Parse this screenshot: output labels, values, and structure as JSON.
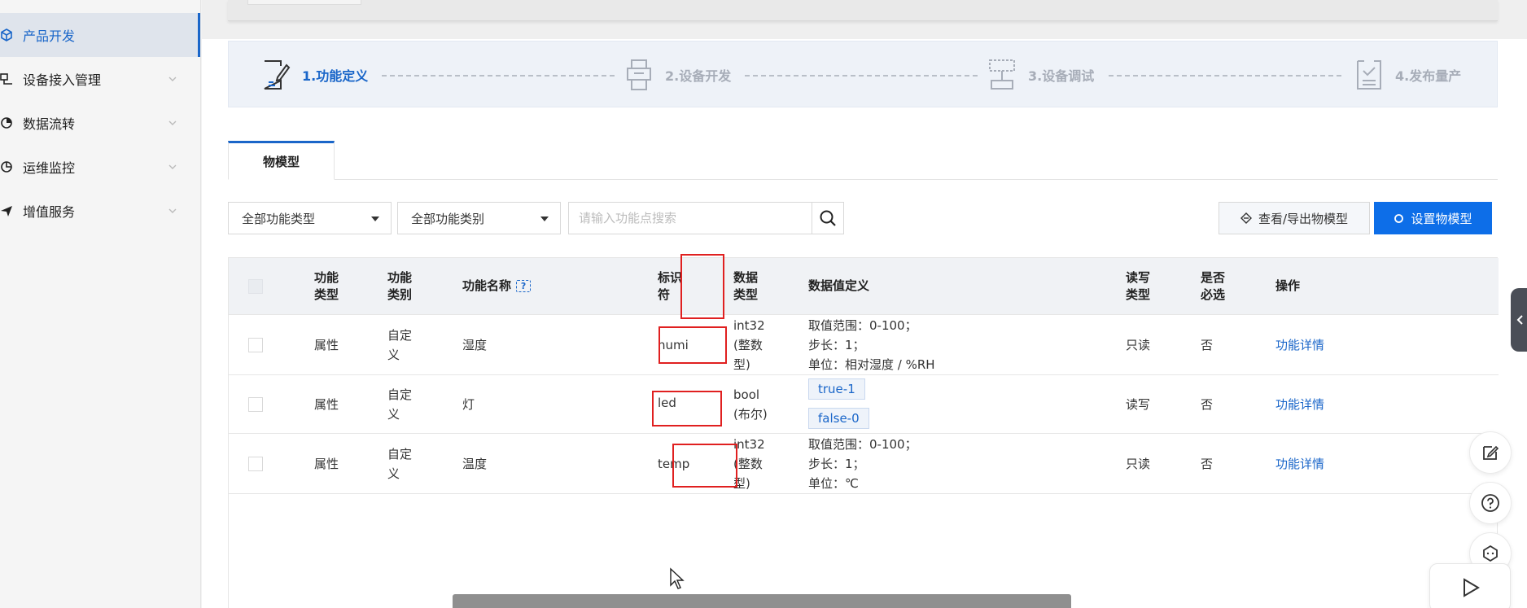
{
  "sidebar": {
    "items": [
      {
        "label": "产品开发",
        "icon": "cube-icon",
        "active": true
      },
      {
        "label": "设备接入管理",
        "icon": "device-icon"
      },
      {
        "label": "数据流转",
        "icon": "flow-icon"
      },
      {
        "label": "运维监控",
        "icon": "chart-icon"
      },
      {
        "label": "增值服务",
        "icon": "send-icon"
      }
    ]
  },
  "steps": [
    {
      "label": "1.功能定义",
      "icon": "edit-doc-icon",
      "active": true
    },
    {
      "label": "2.设备开发",
      "icon": "printer-icon"
    },
    {
      "label": "3.设备调试",
      "icon": "debug-icon"
    },
    {
      "label": "4.发布量产",
      "icon": "publish-icon"
    }
  ],
  "tabs": [
    {
      "label": "物模型"
    }
  ],
  "filters": {
    "type_select": "全部功能类型",
    "category_select": "全部功能类别",
    "search_placeholder": "请输入功能点搜索",
    "view_export_label": "查看/导出物模型",
    "set_model_label": "设置物模型"
  },
  "table": {
    "headers": {
      "func_type": "功能\n类型",
      "func_category": "功能\n类别",
      "func_name": "功能名称",
      "identifier": "标识\n符",
      "data_type": "数据\n类型",
      "data_def": "数据值定义",
      "rw_type": "读写\n类型",
      "required": "是否\n必选",
      "action": "操作"
    },
    "rows": [
      {
        "type": "属性",
        "category": "自定\n义",
        "name": "湿度",
        "identifier": "humi",
        "data_type": "int32\n(整数\n型)",
        "def_lines": [
          "取值范围：0-100；",
          "步长：1；",
          "单位：相对湿度 / %RH"
        ],
        "rw": "只读",
        "required": "否",
        "action": "功能详情"
      },
      {
        "type": "属性",
        "category": "自定\n义",
        "name": "灯",
        "identifier": "led",
        "data_type": "bool\n(布尔)",
        "tags": [
          "true-1",
          "false-0"
        ],
        "rw": "读写",
        "required": "否",
        "action": "功能详情"
      },
      {
        "type": "属性",
        "category": "自定\n义",
        "name": "温度",
        "identifier": "temp",
        "data_type": "int32\n(整数\n型)",
        "def_lines": [
          "取值范围：0-100；",
          "步长：1；",
          "单位：℃"
        ],
        "rw": "只读",
        "required": "否",
        "action": "功能详情"
      }
    ]
  },
  "colors": {
    "primary": "#0d6ee8",
    "link": "#1a66c9",
    "highlight": "#e02020"
  }
}
